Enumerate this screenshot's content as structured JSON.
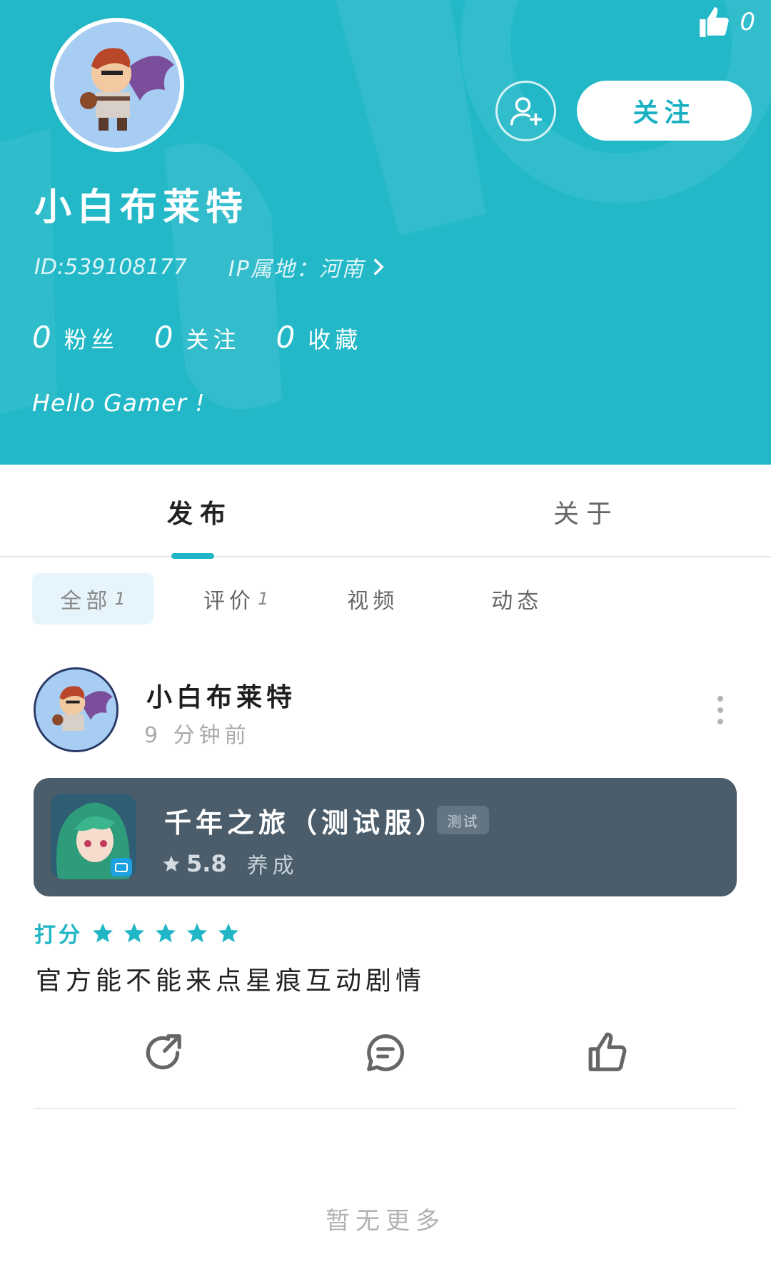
{
  "header": {
    "like_count": "0",
    "follow_button": "关注",
    "username": "小白布莱特",
    "id_text": "ID:539108177",
    "ip_text": "IP属地：河南",
    "stats": [
      {
        "num": "0",
        "label": "粉丝"
      },
      {
        "num": "0",
        "label": "关注"
      },
      {
        "num": "0",
        "label": "收藏"
      }
    ],
    "bio": "Hello Gamer !"
  },
  "main_tabs": [
    {
      "label": "发布",
      "active": true
    },
    {
      "label": "关于",
      "active": false
    }
  ],
  "sub_tabs": [
    {
      "label": "全部",
      "count": "1",
      "active": true
    },
    {
      "label": "评价",
      "count": "1"
    },
    {
      "label": "视频",
      "count": ""
    },
    {
      "label": "动态",
      "count": ""
    }
  ],
  "post": {
    "username": "小白布莱特",
    "time": "9 分钟前",
    "game": {
      "title": "千年之旅（测试服）",
      "tag": "测试",
      "score": "5.8",
      "genre": "养成"
    },
    "rating_label": "打分",
    "rating_stars": 5,
    "review": "官方能不能来点星痕互动剧情"
  },
  "footer_text": "暂无更多",
  "colors": {
    "accent": "#22b8c8",
    "card": "#4b5d6b"
  }
}
